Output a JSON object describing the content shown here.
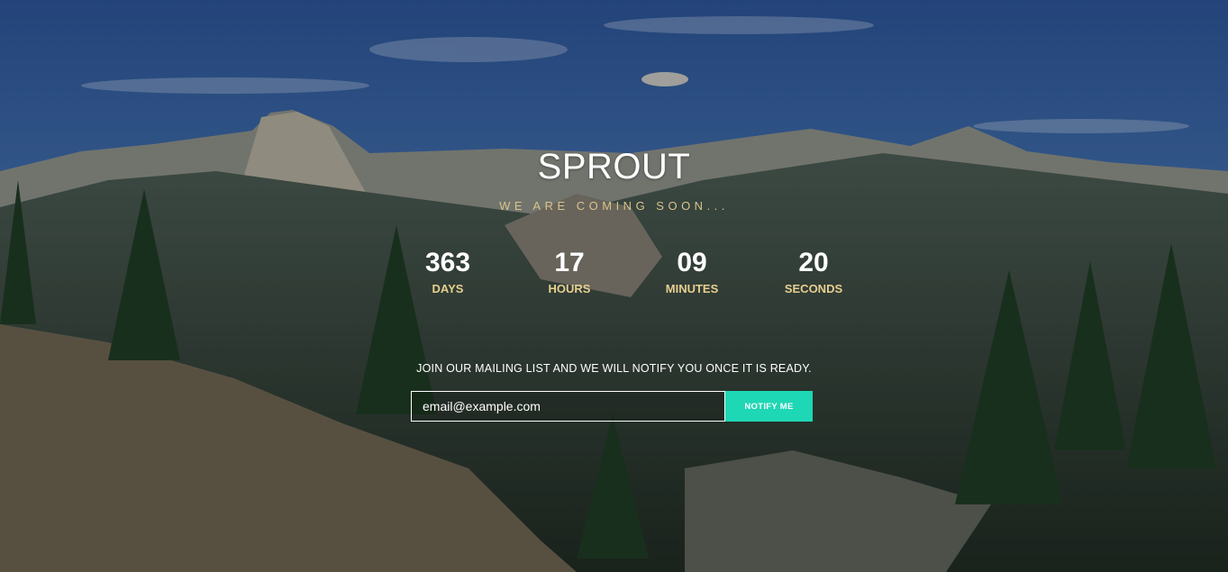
{
  "brand": {
    "title": "SPROUT",
    "tagline": "WE ARE COMING SOON..."
  },
  "countdown": [
    {
      "value": "363",
      "label": "DAYS"
    },
    {
      "value": "17",
      "label": "HOURS"
    },
    {
      "value": "09",
      "label": "MINUTES"
    },
    {
      "value": "20",
      "label": "SECONDS"
    }
  ],
  "mailing": {
    "text": "JOIN OUR MAILING LIST AND WE WILL NOTIFY YOU ONCE IT IS READY.",
    "email_value": "email@example.com",
    "button_label": "NOTIFY ME"
  },
  "colors": {
    "accent": "#1ed7b5",
    "gold": "#e6cf8f"
  },
  "background": "mountain-valley-photo"
}
